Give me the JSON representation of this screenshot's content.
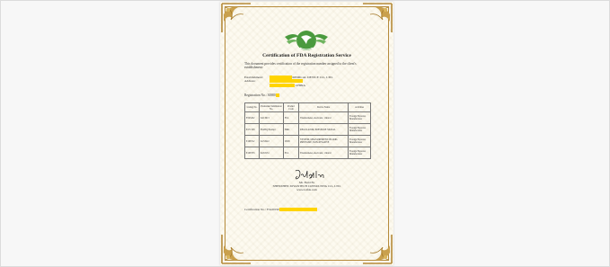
{
  "document": {
    "title": "Certification of FDA Registration Service",
    "intro": "This document provides certification of the registration number assigned to the client's establishment:",
    "establishment_label": "Establishment:",
    "establishment_suffix": "MEDICAL DEVICE CO., LTD.",
    "address_label": "Address:",
    "address_suffix": "CHINA",
    "registration_label": "Registration No.: 30080",
    "table": {
      "headers": [
        "Listing No.",
        "Premarket Submission No.",
        "Product Code",
        "Device Name",
        "Activities"
      ],
      "rows": [
        [
          "E525202",
          "K213613",
          "FLL",
          "Thermometer, electronic, clinical",
          "Foreign Exporter, Manufacturer"
        ],
        [
          "E271328",
          "FIAHQ Exempt",
          "BRK",
          "REGULATOR, PRESSURE SIGNAL",
          "Foreign Exporter, Manufacturer"
        ],
        [
          "E108722",
          "K153222",
          "DXN",
          "SYSTEM, MEASUREMENT, BLOOD-PRESSURE, NON-INVASIVE",
          "Foreign Exporter, Manufacturer"
        ],
        [
          "E108733",
          "K163131",
          "FLL",
          "Thermometer, electronic, clinical",
          "Foreign Exporter, Manufacturer"
        ]
      ]
    },
    "signer_name": "Mr. Field Fu",
    "signer_company": "SHENZHEN JOYANTECH CONSULTING CO., LTD.",
    "signer_web": "www.ioifda.com",
    "cert_label": "Certification No.: FJA20190",
    "colors": {
      "border": "#b58a3a",
      "logo": "#4a9a3e",
      "highlight": "#ffd400"
    }
  }
}
